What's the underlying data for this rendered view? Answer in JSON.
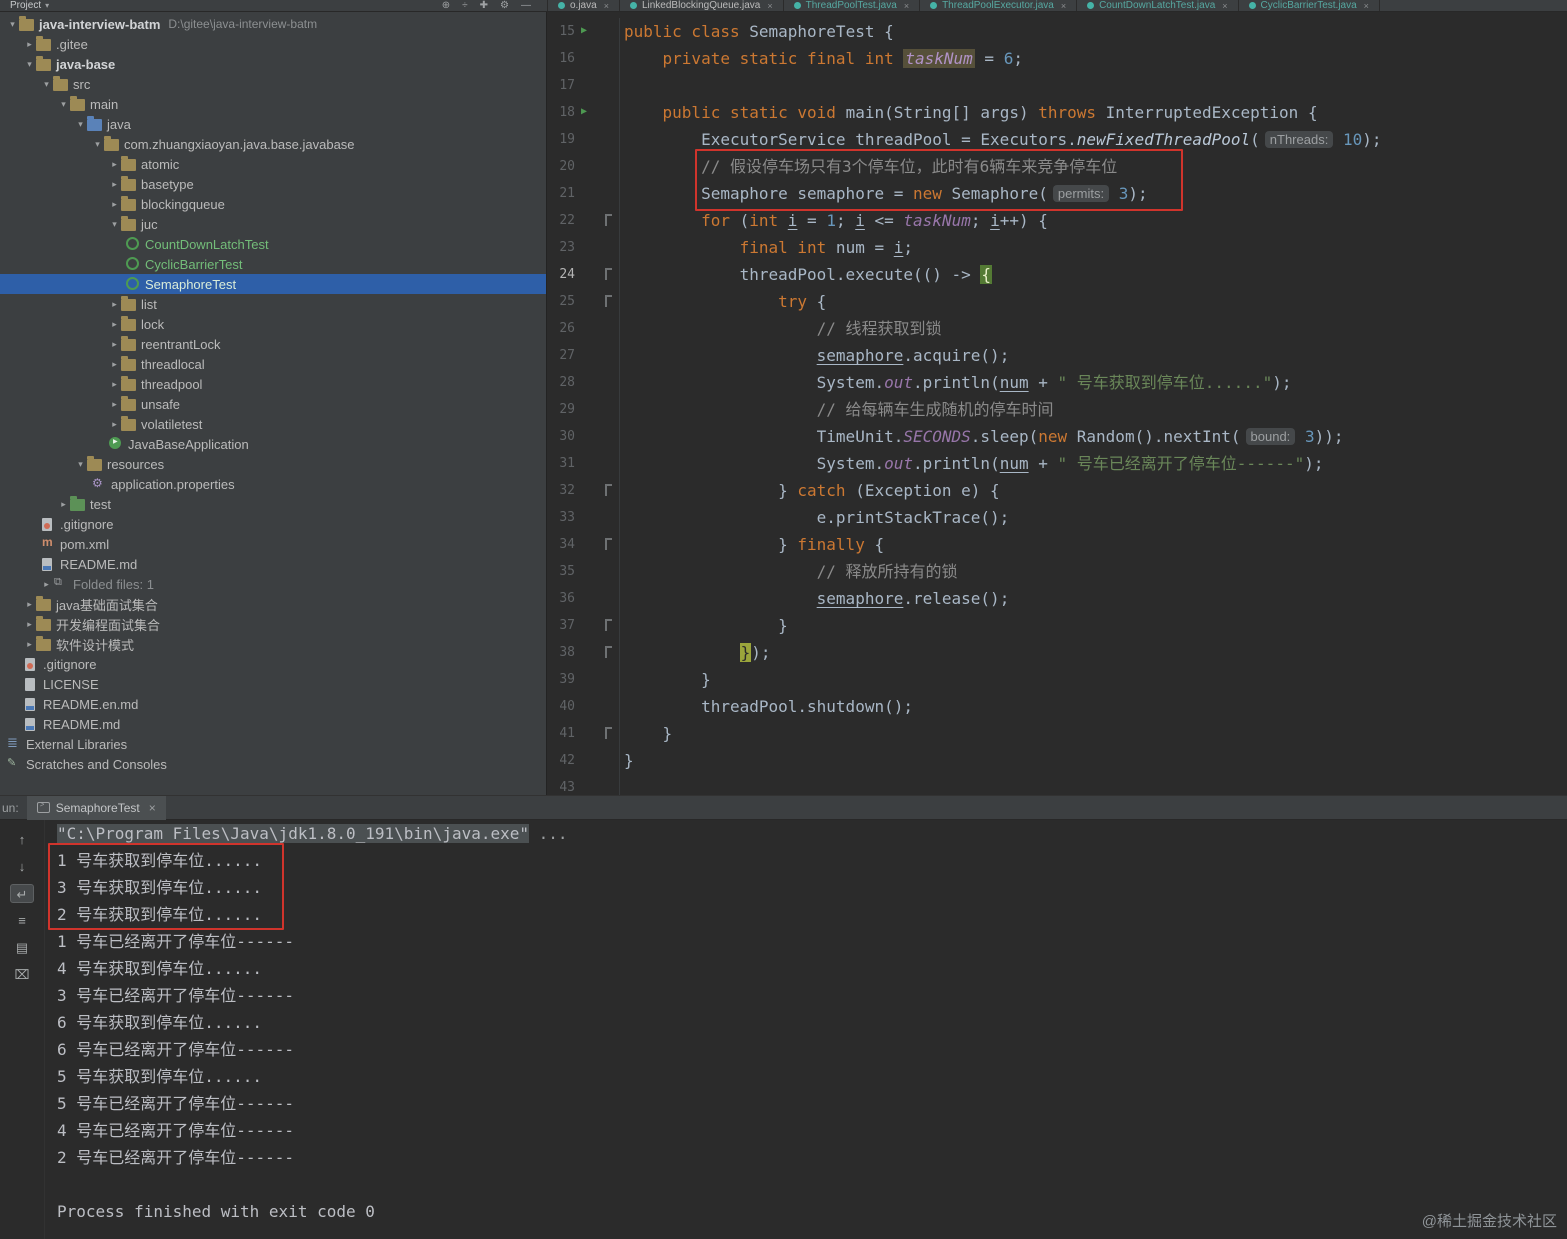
{
  "colors": {
    "panel_bg": "#3c3f41",
    "editor_bg": "#2b2b2b",
    "selection_blue": "#2e5fa8",
    "added_file_green": "#73bd79",
    "keyword_orange": "#cc7832",
    "string_green": "#6a8759",
    "number_blue": "#6897bb",
    "annotation_red": "#d0342c",
    "run_green": "#4e9a52"
  },
  "top": {
    "project_label": "Project",
    "toolbar_icons": [
      "target-icon",
      "compare-icon",
      "add-icon",
      "settings-icon",
      "hide-icon"
    ],
    "editor_tabs": [
      {
        "label": "o.java",
        "teal": false
      },
      {
        "label": "LinkedBlockingQueue.java",
        "teal": false
      },
      {
        "label": "ThreadPoolTest.java",
        "teal": true
      },
      {
        "label": "ThreadPoolExecutor.java",
        "teal": true
      },
      {
        "label": "CountDownLatchTest.java",
        "teal": true
      },
      {
        "label": "CyclicBarrierTest.java",
        "teal": true
      }
    ]
  },
  "project_tree": {
    "items": [
      {
        "indent": 0,
        "arrow": "down",
        "icon": "folder",
        "label": "java-interview-batm",
        "hint": "D:\\gitee\\java-interview-batm",
        "bold": true
      },
      {
        "indent": 1,
        "arrow": "right",
        "icon": "folder",
        "label": ".gitee"
      },
      {
        "indent": 1,
        "arrow": "down",
        "icon": "folder",
        "label": "java-base",
        "bold": true
      },
      {
        "indent": 2,
        "arrow": "down",
        "icon": "folder",
        "label": "src"
      },
      {
        "indent": 3,
        "arrow": "down",
        "icon": "folder",
        "label": "main"
      },
      {
        "indent": 4,
        "arrow": "down",
        "icon": "folder-java",
        "label": "java"
      },
      {
        "indent": 5,
        "arrow": "down",
        "icon": "folder",
        "label": "com.zhuangxiaoyan.java.base.javabase"
      },
      {
        "indent": 6,
        "arrow": "right",
        "icon": "folder",
        "label": "atomic"
      },
      {
        "indent": 6,
        "arrow": "right",
        "icon": "folder",
        "label": "basetype"
      },
      {
        "indent": 6,
        "arrow": "right",
        "icon": "folder",
        "label": "blockingqueue"
      },
      {
        "indent": 6,
        "arrow": "down",
        "icon": "folder",
        "label": "juc"
      },
      {
        "indent": 7,
        "icon": "class",
        "label": "CountDownLatchTest",
        "added": true
      },
      {
        "indent": 7,
        "icon": "class",
        "label": "CyclicBarrierTest",
        "added": true
      },
      {
        "indent": 7,
        "icon": "class",
        "label": "SemaphoreTest",
        "added": true,
        "selected": true
      },
      {
        "indent": 6,
        "arrow": "right",
        "icon": "folder",
        "label": "list"
      },
      {
        "indent": 6,
        "arrow": "right",
        "icon": "folder",
        "label": "lock"
      },
      {
        "indent": 6,
        "arrow": "right",
        "icon": "folder",
        "label": "reentrantLock"
      },
      {
        "indent": 6,
        "arrow": "right",
        "icon": "folder",
        "label": "threadlocal"
      },
      {
        "indent": 6,
        "arrow": "right",
        "icon": "folder",
        "label": "threadpool"
      },
      {
        "indent": 6,
        "arrow": "right",
        "icon": "folder",
        "label": "unsafe"
      },
      {
        "indent": 6,
        "arrow": "right",
        "icon": "folder",
        "label": "volatiletest"
      },
      {
        "indent": 6,
        "icon": "app",
        "label": "JavaBaseApplication"
      },
      {
        "indent": 4,
        "arrow": "down",
        "icon": "folder-res",
        "label": "resources"
      },
      {
        "indent": 5,
        "icon": "gear",
        "label": "application.properties"
      },
      {
        "indent": 3,
        "arrow": "right",
        "icon": "folder-test",
        "label": "test"
      },
      {
        "indent": 2,
        "icon": "git",
        "label": ".gitignore"
      },
      {
        "indent": 2,
        "icon": "maven",
        "label": "pom.xml"
      },
      {
        "indent": 2,
        "icon": "md",
        "label": "README.md"
      },
      {
        "indent": 2,
        "arrow": "right",
        "icon": "folded",
        "label": "Folded files: 1",
        "dim": true
      },
      {
        "indent": 1,
        "arrow": "right",
        "icon": "folder",
        "label": "java基础面试集合"
      },
      {
        "indent": 1,
        "arrow": "right",
        "icon": "folder",
        "label": "开发编程面试集合"
      },
      {
        "indent": 1,
        "arrow": "right",
        "icon": "folder",
        "label": "软件设计模式"
      },
      {
        "indent": 1,
        "icon": "git",
        "label": ".gitignore"
      },
      {
        "indent": 1,
        "icon": "doc",
        "label": "LICENSE"
      },
      {
        "indent": 1,
        "icon": "md",
        "label": "README.en.md"
      },
      {
        "indent": 1,
        "icon": "md",
        "label": "README.md"
      },
      {
        "indent": 0,
        "icon": "lib",
        "label": "External Libraries"
      },
      {
        "indent": 0,
        "icon": "scratch",
        "label": "Scratches and Consoles"
      }
    ]
  },
  "editor": {
    "lines": [
      {
        "ln": 15,
        "run": true,
        "tok": [
          [
            "k",
            "public class "
          ],
          [
            "t",
            "SemaphoreTest {"
          ]
        ]
      },
      {
        "ln": 16,
        "tok": [
          [
            "t",
            "    "
          ],
          [
            "k",
            "private static final int "
          ],
          [
            "fh",
            "taskNum"
          ],
          [
            "t",
            " = "
          ],
          [
            "num",
            "6"
          ],
          [
            "t",
            ";"
          ]
        ]
      },
      {
        "ln": 17,
        "tok": []
      },
      {
        "ln": 18,
        "run": true,
        "tok": [
          [
            "t",
            "    "
          ],
          [
            "k",
            "public static void "
          ],
          [
            "t",
            "main(String[] args) "
          ],
          [
            "k",
            "throws"
          ],
          [
            "t",
            " InterruptedException {"
          ]
        ]
      },
      {
        "ln": 19,
        "tok": [
          [
            "t",
            "        ExecutorService threadPool = Executors."
          ],
          [
            "m",
            "newFixedThreadPool"
          ],
          [
            "t",
            "("
          ],
          [
            "h",
            "nThreads:"
          ],
          [
            "t",
            " "
          ],
          [
            "num",
            "10"
          ],
          [
            "t",
            ");"
          ]
        ]
      },
      {
        "ln": 20,
        "tok": [
          [
            "c",
            "        // 假设停车场只有3个停车位，此时有6辆车来竞争停车位"
          ]
        ]
      },
      {
        "ln": 21,
        "tok": [
          [
            "t",
            "        Semaphore semaphore = "
          ],
          [
            "k",
            "new"
          ],
          [
            "t",
            " Semaphore("
          ],
          [
            "h",
            "permits:"
          ],
          [
            "t",
            " "
          ],
          [
            "num",
            "3"
          ],
          [
            "t",
            ");"
          ]
        ]
      },
      {
        "ln": 22,
        "fold": true,
        "tok": [
          [
            "t",
            "        "
          ],
          [
            "k",
            "for"
          ],
          [
            "t",
            " ("
          ],
          [
            "k",
            "int"
          ],
          [
            "t",
            " "
          ],
          [
            "u",
            "i"
          ],
          [
            "t",
            " = "
          ],
          [
            "num",
            "1"
          ],
          [
            "t",
            "; "
          ],
          [
            "u",
            "i"
          ],
          [
            "t",
            " <= "
          ],
          [
            "f",
            "taskNum"
          ],
          [
            "t",
            "; "
          ],
          [
            "u",
            "i"
          ],
          [
            "t",
            "++) {"
          ]
        ]
      },
      {
        "ln": 23,
        "tok": [
          [
            "t",
            "            "
          ],
          [
            "k",
            "final int"
          ],
          [
            "t",
            " num = "
          ],
          [
            "u",
            "i"
          ],
          [
            "t",
            ";"
          ]
        ]
      },
      {
        "ln": 24,
        "fold": true,
        "active": true,
        "tok": [
          [
            "t",
            "            threadPool.execute(() -> "
          ],
          [
            "b1",
            "{"
          ]
        ]
      },
      {
        "ln": 25,
        "fold": true,
        "tok": [
          [
            "t",
            "                "
          ],
          [
            "k",
            "try"
          ],
          [
            "t",
            " {"
          ]
        ]
      },
      {
        "ln": 26,
        "tok": [
          [
            "c",
            "                    // 线程获取到锁"
          ]
        ]
      },
      {
        "ln": 27,
        "tok": [
          [
            "t",
            "                    "
          ],
          [
            "u",
            "semaphore"
          ],
          [
            "t",
            ".acquire();"
          ]
        ]
      },
      {
        "ln": 28,
        "tok": [
          [
            "t",
            "                    System."
          ],
          [
            "f",
            "out"
          ],
          [
            "t",
            ".println("
          ],
          [
            "u",
            "num"
          ],
          [
            "t",
            " + "
          ],
          [
            "s",
            "\" 号车获取到停车位......\""
          ],
          [
            "t",
            ");"
          ]
        ]
      },
      {
        "ln": 29,
        "tok": [
          [
            "c",
            "                    // 给每辆车生成随机的停车时间"
          ]
        ]
      },
      {
        "ln": 30,
        "tok": [
          [
            "t",
            "                    TimeUnit."
          ],
          [
            "f",
            "SECONDS"
          ],
          [
            "t",
            ".sleep("
          ],
          [
            "k",
            "new"
          ],
          [
            "t",
            " Random().nextInt("
          ],
          [
            "h",
            "bound:"
          ],
          [
            "t",
            " "
          ],
          [
            "num",
            "3"
          ],
          [
            "t",
            "));"
          ]
        ]
      },
      {
        "ln": 31,
        "tok": [
          [
            "t",
            "                    System."
          ],
          [
            "f",
            "out"
          ],
          [
            "t",
            ".println("
          ],
          [
            "u",
            "num"
          ],
          [
            "t",
            " + "
          ],
          [
            "s",
            "\" 号车已经离开了停车位------\""
          ],
          [
            "t",
            ");"
          ]
        ]
      },
      {
        "ln": 32,
        "fold": true,
        "tok": [
          [
            "t",
            "                } "
          ],
          [
            "k",
            "catch"
          ],
          [
            "t",
            " (Exception e) {"
          ]
        ]
      },
      {
        "ln": 33,
        "tok": [
          [
            "t",
            "                    e.printStackTrace();"
          ]
        ]
      },
      {
        "ln": 34,
        "fold": true,
        "tok": [
          [
            "t",
            "                } "
          ],
          [
            "k",
            "finally"
          ],
          [
            "t",
            " {"
          ]
        ]
      },
      {
        "ln": 35,
        "tok": [
          [
            "c",
            "                    // 释放所持有的锁"
          ]
        ]
      },
      {
        "ln": 36,
        "tok": [
          [
            "t",
            "                    "
          ],
          [
            "u",
            "semaphore"
          ],
          [
            "t",
            ".release();"
          ]
        ]
      },
      {
        "ln": 37,
        "fold": true,
        "tok": [
          [
            "t",
            "                }"
          ]
        ]
      },
      {
        "ln": 38,
        "fold": true,
        "tok": [
          [
            "t",
            "            "
          ],
          [
            "b2",
            "}"
          ],
          [
            "t",
            ");"
          ]
        ]
      },
      {
        "ln": 39,
        "tok": [
          [
            "t",
            "        }"
          ]
        ]
      },
      {
        "ln": 40,
        "tok": [
          [
            "t",
            "        threadPool.shutdown();"
          ]
        ]
      },
      {
        "ln": 41,
        "fold": true,
        "tok": [
          [
            "t",
            "    }"
          ]
        ]
      },
      {
        "ln": 42,
        "tok": [
          [
            "t",
            "}"
          ]
        ]
      },
      {
        "ln": 43,
        "tok": []
      }
    ]
  },
  "console": {
    "run_label": "un:",
    "tab_label": "SemaphoreTest",
    "close_label": "×",
    "toolbar_icons": [
      "up-arrow",
      "down-arrow",
      "soft-wrap",
      "scroll-end",
      "print",
      "clear"
    ],
    "cmd": "\"C:\\Program Files\\Java\\jdk1.8.0_191\\bin\\java.exe\"",
    "cmd_suffix": " ...",
    "lines": [
      "1 号车获取到停车位......",
      "3 号车获取到停车位......",
      "2 号车获取到停车位......",
      "1 号车已经离开了停车位------",
      "4 号车获取到停车位......",
      "3 号车已经离开了停车位------",
      "6 号车获取到停车位......",
      "6 号车已经离开了停车位------",
      "5 号车获取到停车位......",
      "5 号车已经离开了停车位------",
      "4 号车已经离开了停车位------",
      "2 号车已经离开了停车位------"
    ],
    "exit_line": "Process finished with exit code 0"
  },
  "watermark": "@稀土掘金技术社区"
}
